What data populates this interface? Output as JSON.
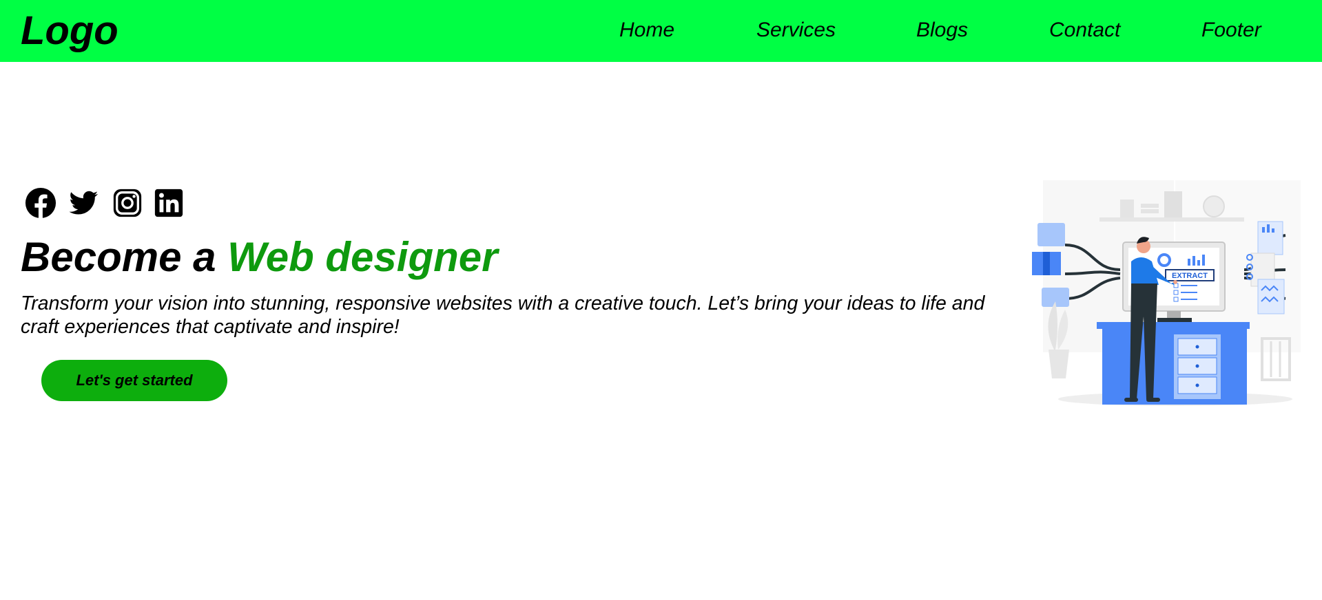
{
  "header": {
    "logo": "Logo",
    "nav": [
      {
        "label": "Home"
      },
      {
        "label": "Services"
      },
      {
        "label": "Blogs"
      },
      {
        "label": "Contact"
      },
      {
        "label": "Footer"
      }
    ]
  },
  "social": {
    "icons": [
      "facebook-icon",
      "twitter-icon",
      "instagram-icon",
      "linkedin-icon"
    ]
  },
  "hero": {
    "headline_prefix": "Become a ",
    "headline_accent": "Web designer",
    "tagline": "Transform your vision into stunning, responsive websites with a creative touch. Let’s bring your ideas to life and craft experiences that captivate and inspire!",
    "cta_label": "Let's get started"
  },
  "illustration": {
    "screen_label": "EXTRACT"
  },
  "colors": {
    "nav_bg": "#00ff44",
    "accent_text": "#0e9a0e",
    "cta_bg": "#0dae0d",
    "illustration_blue": "#4a86f7"
  }
}
